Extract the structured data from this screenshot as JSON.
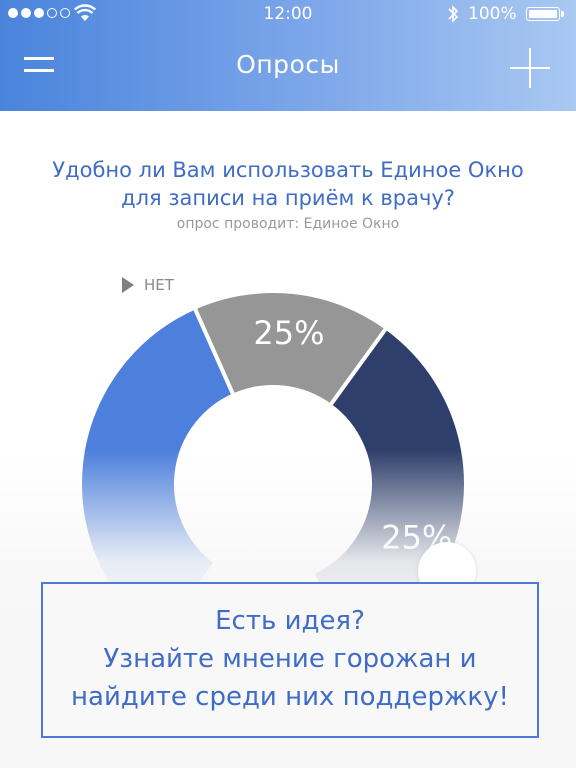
{
  "status": {
    "time": "12:00",
    "battery": "100%",
    "signal_dots_filled": 3,
    "signal_dots_total": 5
  },
  "header": {
    "title": "Опросы",
    "menu_icon": "hamburger-icon",
    "add_icon": "plus-icon"
  },
  "poll": {
    "question_line1": "Удобно ли Вам использовать Единое Окно",
    "question_line2": "для записи на приём к врачу?",
    "conductor": "опрос проводит: Единое Окно",
    "legend_label": "НЕТ"
  },
  "chart_data": {
    "type": "pie",
    "shape": "donut",
    "visible_labels": [
      "25%",
      "25%"
    ],
    "slices": [
      {
        "name": "НЕТ",
        "value": 25,
        "label": "25%",
        "color": "#969696"
      },
      {
        "name": "",
        "value": 25,
        "label": "25%",
        "color": "#2f3f6b"
      },
      {
        "name": "",
        "value": 25,
        "label": "",
        "color": "#4d7fdc"
      }
    ]
  },
  "idea": {
    "line1": "Есть идея?",
    "line2": "Узнайте мнение горожан и",
    "line3": "найдите среди них поддержку!"
  },
  "colors": {
    "accent": "#3f6cc6",
    "header_start": "#4a84dc",
    "header_end": "#a9c8f2"
  }
}
